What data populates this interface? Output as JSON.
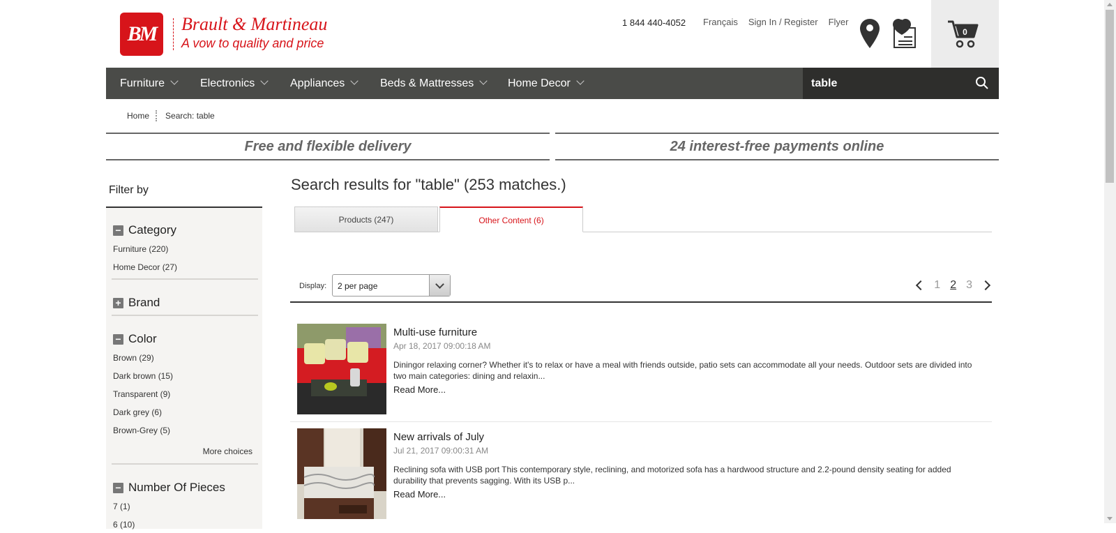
{
  "header": {
    "logo_letters": "BM",
    "brand_name": "Brault & Martineau",
    "tagline": "A vow to quality and price",
    "phone": "1 844 440-4052",
    "links": [
      "Français",
      "Sign In / Register",
      "Flyer"
    ],
    "cart_count": "0"
  },
  "nav": {
    "items": [
      "Furniture",
      "Electronics",
      "Appliances",
      "Beds & Mattresses",
      "Home Decor"
    ],
    "search_value": "table"
  },
  "breadcrumb": {
    "home": "Home",
    "current": "Search: table"
  },
  "banners": {
    "delivery": "Free and flexible delivery",
    "payments": "24 interest-free payments online"
  },
  "sidebar": {
    "title": "Filter by",
    "category": {
      "label": "Category",
      "options": [
        "Furniture (220)",
        "Home Decor (27)"
      ]
    },
    "brand": {
      "label": "Brand"
    },
    "color": {
      "label": "Color",
      "options": [
        "Brown (29)",
        "Dark brown (15)",
        "Transparent (9)",
        "Dark grey (6)",
        "Brown-Grey (5)"
      ],
      "more": "More choices"
    },
    "pieces": {
      "label": "Number Of Pieces",
      "options": [
        "7 (1)",
        "6 (10)"
      ]
    }
  },
  "main": {
    "results_title": "Search results for \"table\" (253 matches.)",
    "tabs": [
      "Products (247)",
      "Other Content (6)"
    ],
    "display_label": "Display:",
    "display_value": "2 per page",
    "pages": [
      "1",
      "2",
      "3"
    ],
    "results": [
      {
        "title": "Multi-use furniture",
        "date": "Apr 18, 2017 09:00:18 AM",
        "desc": "Diningor relaxing corner? Whether it's to relax or have a meal with friends outside, patio sets can accommodate all your needs. Outdoor sets are divided into two main categories: dining and relaxin...",
        "more": "Read More..."
      },
      {
        "title": "New arrivals of July",
        "date": "Jul 21, 2017 09:00:31 AM",
        "desc": "Reclining sofa with USB port This contemporary style, reclining, and motorized sofa has a hardwood structure and 2.2-pound density seating for added durability that prevents sagging. With its USB p...",
        "more": "Read More..."
      }
    ]
  },
  "colors": {
    "brand_red": "#d7141a",
    "nav_bg": "#4a4b48",
    "search_bg": "#2e2e2c"
  }
}
